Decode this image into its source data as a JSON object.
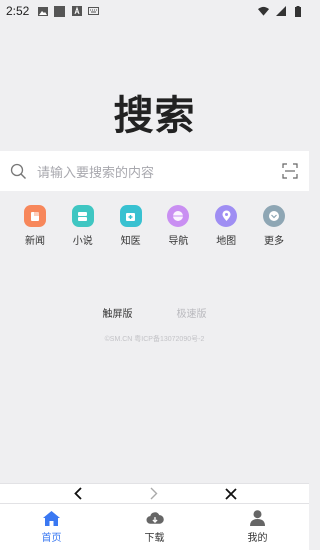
{
  "status_bar": {
    "time": "2:52",
    "left_icons": [
      "image-icon",
      "square-icon",
      "a-icon",
      "keyboard-icon"
    ],
    "right_icons": [
      "wifi-icon",
      "signal-icon",
      "battery-icon"
    ]
  },
  "logo": {
    "text": "搜索"
  },
  "search": {
    "placeholder": "请输入要搜索的内容",
    "search_icon": "search-icon",
    "scan_icon": "scan-icon"
  },
  "quick_links": [
    {
      "label": "新闻",
      "icon": "news-icon",
      "color": "#f7875b"
    },
    {
      "label": "小说",
      "icon": "novel-icon",
      "color": "#3fc6c2"
    },
    {
      "label": "知医",
      "icon": "medical-icon",
      "color": "#38c1d1"
    },
    {
      "label": "导航",
      "icon": "navigation-icon",
      "color": "#c98ff2"
    },
    {
      "label": "地图",
      "icon": "map-icon",
      "color": "#9f8ef3"
    },
    {
      "label": "更多",
      "icon": "more-icon",
      "color": "#8ea6b4"
    }
  ],
  "mode_switch": {
    "touch_label": "触屏版",
    "fast_label": "极速版"
  },
  "footer": {
    "icp": "©SM.CN 粤ICP备13072090号-2"
  },
  "browser_nav": {
    "back_icon": "chevron-left-icon",
    "forward_icon": "chevron-right-icon",
    "close_icon": "close-icon"
  },
  "tab_bar": {
    "tabs": [
      {
        "label": "首页",
        "icon": "home-icon",
        "active": true
      },
      {
        "label": "下载",
        "icon": "cloud-download-icon",
        "active": false
      },
      {
        "label": "我的",
        "icon": "user-icon",
        "active": false
      }
    ],
    "active_color": "#3a78f2"
  }
}
